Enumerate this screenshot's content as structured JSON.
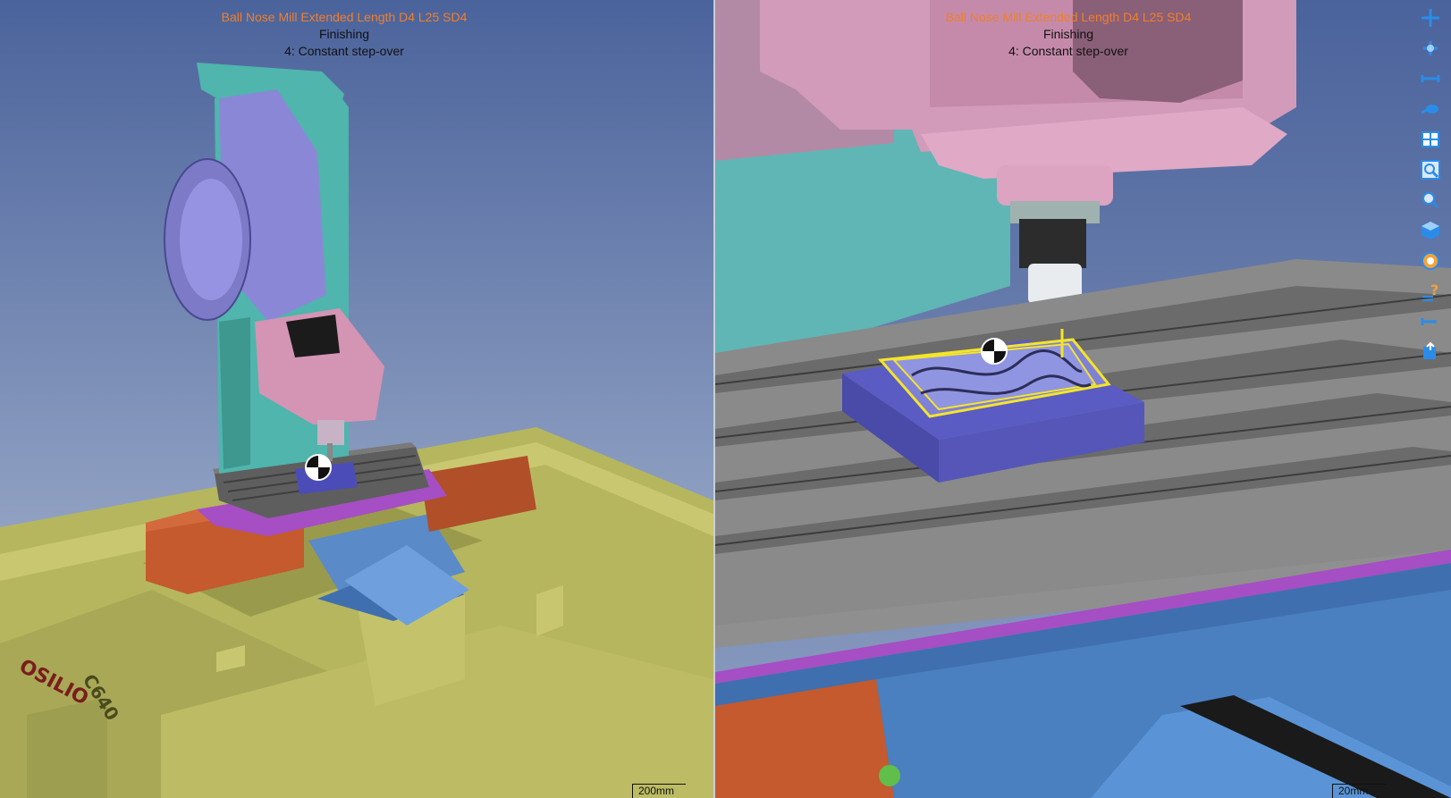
{
  "left_view": {
    "tool_name": "Ball Nose Mill Extended Length D4 L25 SD4",
    "operation": "Finishing",
    "strategy": "4: Constant step-over",
    "scale_label": "200mm",
    "machine_brand": "OSILIO",
    "machine_model": "C640"
  },
  "right_view": {
    "tool_name": "Ball Nose Mill Extended Length D4 L25 SD4",
    "operation": "Finishing",
    "strategy": "4: Constant step-over",
    "scale_label": "20mm"
  },
  "toolbar": {
    "items": [
      {
        "icon": "pan-move-icon"
      },
      {
        "icon": "rotate-view-icon"
      },
      {
        "icon": "fit-view-icon"
      },
      {
        "icon": "view-direction-icon"
      },
      {
        "icon": "split-view-icon"
      },
      {
        "icon": "zoom-window-icon"
      },
      {
        "icon": "zoom-icon"
      },
      {
        "icon": "shaded-cube-icon"
      },
      {
        "icon": "color-style-icon"
      },
      {
        "icon": "help-query-icon"
      },
      {
        "icon": "tool-length-icon"
      },
      {
        "icon": "export-icon"
      }
    ]
  },
  "colors": {
    "background_top": "#4b639c",
    "background_bottom": "#c4cad4",
    "accent_orange": "#f07f2a",
    "toolpath_yellow": "#f4e52a",
    "machine_yellow": "#b6b65e",
    "stock_blue": "#5b5bc4"
  }
}
